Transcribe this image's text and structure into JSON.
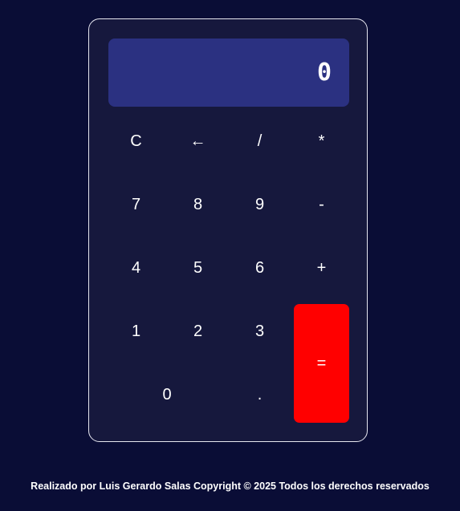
{
  "display": {
    "value": "0"
  },
  "keys": {
    "clear": "C",
    "backspace": "←",
    "divide": "/",
    "multiply": "*",
    "seven": "7",
    "eight": "8",
    "nine": "9",
    "subtract": "-",
    "four": "4",
    "five": "5",
    "six": "6",
    "add": "+",
    "one": "1",
    "two": "2",
    "three": "3",
    "equals": "=",
    "zero": "0",
    "decimal": "."
  },
  "colors": {
    "page_background": "#0a0d36",
    "calculator_background": "#16183d",
    "display_background": "#2b3181",
    "equals_button": "#ff0000",
    "text": "#ffffff"
  },
  "footer": {
    "text": "Realizado por Luis Gerardo Salas Copyright © 2025 Todos los derechos reservados"
  }
}
